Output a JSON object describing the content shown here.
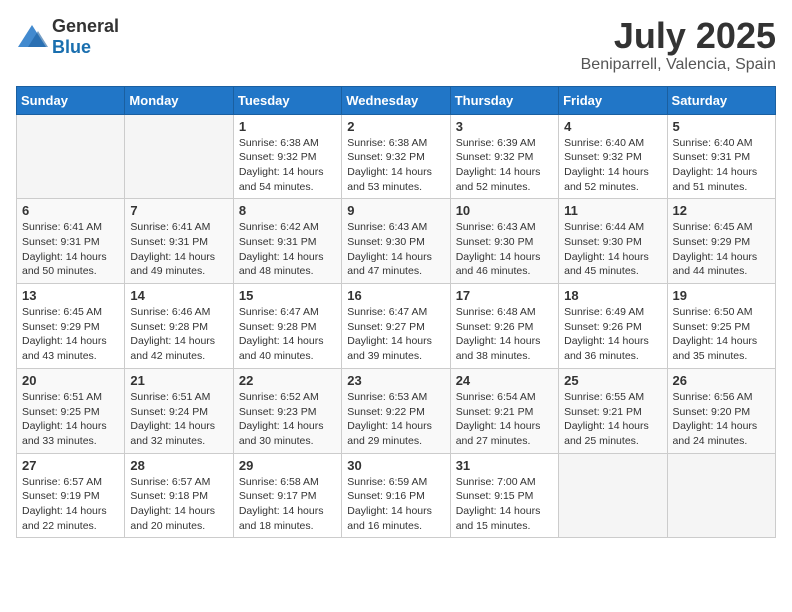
{
  "header": {
    "logo_general": "General",
    "logo_blue": "Blue",
    "month": "July 2025",
    "location": "Beniparrell, Valencia, Spain"
  },
  "weekdays": [
    "Sunday",
    "Monday",
    "Tuesday",
    "Wednesday",
    "Thursday",
    "Friday",
    "Saturday"
  ],
  "weeks": [
    [
      {
        "day": "",
        "content": ""
      },
      {
        "day": "",
        "content": ""
      },
      {
        "day": "1",
        "content": "Sunrise: 6:38 AM\nSunset: 9:32 PM\nDaylight: 14 hours and 54 minutes."
      },
      {
        "day": "2",
        "content": "Sunrise: 6:38 AM\nSunset: 9:32 PM\nDaylight: 14 hours and 53 minutes."
      },
      {
        "day": "3",
        "content": "Sunrise: 6:39 AM\nSunset: 9:32 PM\nDaylight: 14 hours and 52 minutes."
      },
      {
        "day": "4",
        "content": "Sunrise: 6:40 AM\nSunset: 9:32 PM\nDaylight: 14 hours and 52 minutes."
      },
      {
        "day": "5",
        "content": "Sunrise: 6:40 AM\nSunset: 9:31 PM\nDaylight: 14 hours and 51 minutes."
      }
    ],
    [
      {
        "day": "6",
        "content": "Sunrise: 6:41 AM\nSunset: 9:31 PM\nDaylight: 14 hours and 50 minutes."
      },
      {
        "day": "7",
        "content": "Sunrise: 6:41 AM\nSunset: 9:31 PM\nDaylight: 14 hours and 49 minutes."
      },
      {
        "day": "8",
        "content": "Sunrise: 6:42 AM\nSunset: 9:31 PM\nDaylight: 14 hours and 48 minutes."
      },
      {
        "day": "9",
        "content": "Sunrise: 6:43 AM\nSunset: 9:30 PM\nDaylight: 14 hours and 47 minutes."
      },
      {
        "day": "10",
        "content": "Sunrise: 6:43 AM\nSunset: 9:30 PM\nDaylight: 14 hours and 46 minutes."
      },
      {
        "day": "11",
        "content": "Sunrise: 6:44 AM\nSunset: 9:30 PM\nDaylight: 14 hours and 45 minutes."
      },
      {
        "day": "12",
        "content": "Sunrise: 6:45 AM\nSunset: 9:29 PM\nDaylight: 14 hours and 44 minutes."
      }
    ],
    [
      {
        "day": "13",
        "content": "Sunrise: 6:45 AM\nSunset: 9:29 PM\nDaylight: 14 hours and 43 minutes."
      },
      {
        "day": "14",
        "content": "Sunrise: 6:46 AM\nSunset: 9:28 PM\nDaylight: 14 hours and 42 minutes."
      },
      {
        "day": "15",
        "content": "Sunrise: 6:47 AM\nSunset: 9:28 PM\nDaylight: 14 hours and 40 minutes."
      },
      {
        "day": "16",
        "content": "Sunrise: 6:47 AM\nSunset: 9:27 PM\nDaylight: 14 hours and 39 minutes."
      },
      {
        "day": "17",
        "content": "Sunrise: 6:48 AM\nSunset: 9:26 PM\nDaylight: 14 hours and 38 minutes."
      },
      {
        "day": "18",
        "content": "Sunrise: 6:49 AM\nSunset: 9:26 PM\nDaylight: 14 hours and 36 minutes."
      },
      {
        "day": "19",
        "content": "Sunrise: 6:50 AM\nSunset: 9:25 PM\nDaylight: 14 hours and 35 minutes."
      }
    ],
    [
      {
        "day": "20",
        "content": "Sunrise: 6:51 AM\nSunset: 9:25 PM\nDaylight: 14 hours and 33 minutes."
      },
      {
        "day": "21",
        "content": "Sunrise: 6:51 AM\nSunset: 9:24 PM\nDaylight: 14 hours and 32 minutes."
      },
      {
        "day": "22",
        "content": "Sunrise: 6:52 AM\nSunset: 9:23 PM\nDaylight: 14 hours and 30 minutes."
      },
      {
        "day": "23",
        "content": "Sunrise: 6:53 AM\nSunset: 9:22 PM\nDaylight: 14 hours and 29 minutes."
      },
      {
        "day": "24",
        "content": "Sunrise: 6:54 AM\nSunset: 9:21 PM\nDaylight: 14 hours and 27 minutes."
      },
      {
        "day": "25",
        "content": "Sunrise: 6:55 AM\nSunset: 9:21 PM\nDaylight: 14 hours and 25 minutes."
      },
      {
        "day": "26",
        "content": "Sunrise: 6:56 AM\nSunset: 9:20 PM\nDaylight: 14 hours and 24 minutes."
      }
    ],
    [
      {
        "day": "27",
        "content": "Sunrise: 6:57 AM\nSunset: 9:19 PM\nDaylight: 14 hours and 22 minutes."
      },
      {
        "day": "28",
        "content": "Sunrise: 6:57 AM\nSunset: 9:18 PM\nDaylight: 14 hours and 20 minutes."
      },
      {
        "day": "29",
        "content": "Sunrise: 6:58 AM\nSunset: 9:17 PM\nDaylight: 14 hours and 18 minutes."
      },
      {
        "day": "30",
        "content": "Sunrise: 6:59 AM\nSunset: 9:16 PM\nDaylight: 14 hours and 16 minutes."
      },
      {
        "day": "31",
        "content": "Sunrise: 7:00 AM\nSunset: 9:15 PM\nDaylight: 14 hours and 15 minutes."
      },
      {
        "day": "",
        "content": ""
      },
      {
        "day": "",
        "content": ""
      }
    ]
  ]
}
